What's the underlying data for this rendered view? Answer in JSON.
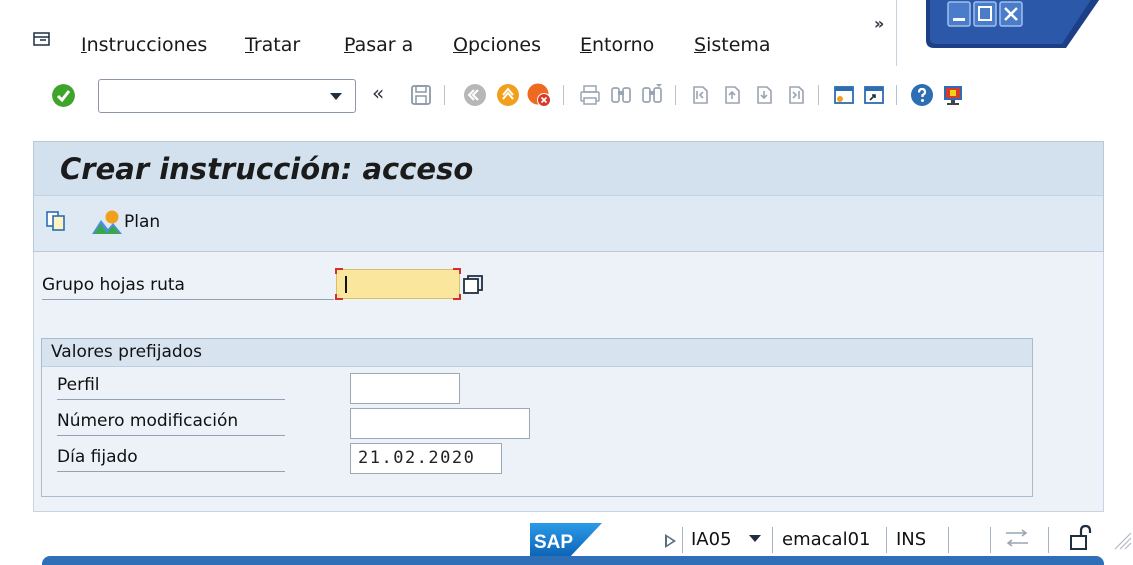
{
  "menubar": {
    "items": [
      {
        "mnemonic": "I",
        "rest": "nstrucciones"
      },
      {
        "mnemonic": "T",
        "rest": "ratar"
      },
      {
        "mnemonic": "P",
        "rest": "asar a"
      },
      {
        "mnemonic": "O",
        "rest": "pciones"
      },
      {
        "mnemonic": "E",
        "rest": "ntorno"
      },
      {
        "mnemonic": "S",
        "rest": "istema"
      }
    ],
    "more": "»"
  },
  "toolbar": {
    "command_field_value": "",
    "back_label": "«"
  },
  "screen": {
    "title": "Crear instrucción: acceso",
    "plan_button_label": "Plan"
  },
  "form": {
    "group_label": "Grupo hojas ruta",
    "group_value": "",
    "defaults_title": "Valores prefijados",
    "profile_label": "Perfil",
    "profile_value": "",
    "change_number_label": "Número modificación",
    "change_number_value": "",
    "key_date_label": "Día fijado",
    "key_date_value": "21.02.2020"
  },
  "statusbar": {
    "transaction": "IA05",
    "user": "emacal01",
    "mode": "INS"
  },
  "icons": {
    "menu": "menu-icon",
    "ok": "checkmark-icon",
    "save": "save-icon",
    "back": "back-icon",
    "exit": "exit-icon",
    "cancel": "cancel-icon",
    "print": "print-icon",
    "find": "find-icon",
    "find_next": "find-next-icon",
    "first_page": "first-page-icon",
    "previous_page": "previous-page-icon",
    "next_page": "next-page-icon",
    "last_page": "last-page-icon",
    "new_session": "new-session-icon",
    "shortcut": "shortcut-icon",
    "help": "help-icon",
    "customize": "customize-layout-icon",
    "copy": "copy-icon",
    "plan": "plan-icon",
    "search_help": "search-help-icon",
    "lock": "lock-icon"
  },
  "colors": {
    "title_bar": "#d3e1ee",
    "required_field": "#fbe69e",
    "accent_blue": "#2f6fb7",
    "ok_green": "#3fa52a"
  }
}
